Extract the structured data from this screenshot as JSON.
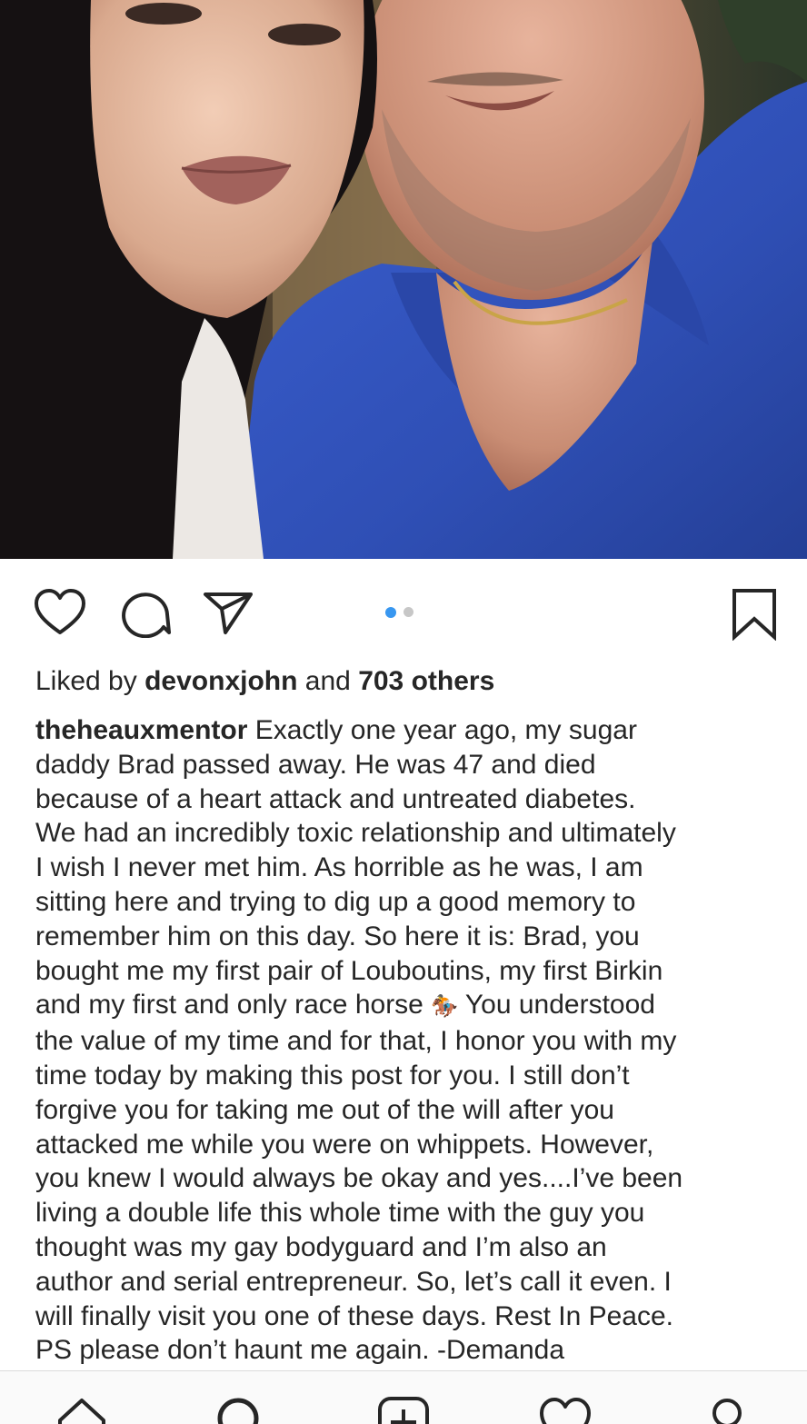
{
  "post": {
    "image_alt": "Selfie of a woman with long dark hair and a man in a blue polo shirt",
    "carousel": {
      "current": 1,
      "total": 2
    },
    "likes": {
      "prefix": "Liked by",
      "user": "devonxjohn",
      "middle": "and",
      "others": "703 others"
    },
    "caption": {
      "username": "theheauxmentor",
      "lines": [
        " Exactly one year ago, my sugar",
        "daddy Brad passed away. He was 47 and died",
        "because of a heart attack and untreated diabetes.",
        "We had an incredibly toxic relationship and ultimately",
        "I wish I never met him. As horrible as he was, I am",
        "sitting here and trying to dig up a good memory to",
        "remember him on this day. So here it is: Brad, you",
        "bought me my first pair of Louboutins, my first Birkin",
        "and my first and only race horse ",
        "the value of my time and for that, I honor you with my",
        "time today by making this post for you. I still don’t",
        "forgive you for taking me out of the will after you",
        "attacked me while you were on whippets. However,",
        "you knew I would always be okay and yes....I’ve been",
        "living a double life this whole time with the guy you",
        "thought was my gay bodyguard and I’m also an",
        "author and serial entrepreneur. So, let’s call it even. I",
        "will finally visit you one of these days. Rest In Peace.",
        "PS please don’t haunt me again. -Demanda"
      ],
      "emoji": "🏇",
      "line9_tail": " You understood"
    }
  },
  "icons": {
    "like": "heart-icon",
    "comment": "comment-bubble-icon",
    "share": "paper-plane-icon",
    "save": "bookmark-icon"
  },
  "bottom_nav": [
    "home-icon",
    "search-icon",
    "new-post-icon",
    "activity-heart-icon",
    "profile-icon"
  ],
  "colors": {
    "text": "#262626",
    "accent_dot": "#3897f0",
    "inactive_dot": "#c7c7c7",
    "shirt_blue": "#2f4fb5",
    "border": "#dbdbdb"
  }
}
